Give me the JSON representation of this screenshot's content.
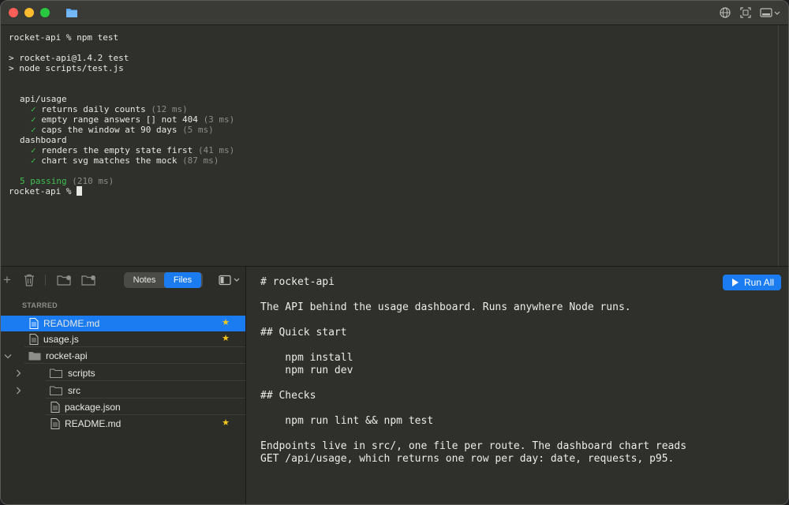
{
  "terminal": {
    "cmd_line": "rocket-api % npm test",
    "script_line1": "> rocket-api@1.4.2 test",
    "script_line2": "> node scripts/test.js",
    "suites": [
      {
        "name": "api/usage",
        "tests": [
          {
            "title": "returns daily counts",
            "time": "(12 ms)"
          },
          {
            "title": "empty range answers [] not 404",
            "time": "(3 ms)"
          },
          {
            "title": "caps the window at 90 days",
            "time": "(5 ms)"
          }
        ]
      },
      {
        "name": "dashboard",
        "tests": [
          {
            "title": "renders the empty state first",
            "time": "(41 ms)"
          },
          {
            "title": "chart svg matches the mock",
            "time": "(87 ms)"
          }
        ]
      }
    ],
    "check": "✓",
    "summary": "5 passing",
    "summary_time": "(210 ms)",
    "prompt": "rocket-api %"
  },
  "sidebar": {
    "tabs": {
      "notes": "Notes",
      "files": "Files"
    },
    "section_label": "STARRED",
    "starred": [
      {
        "name": "README.md",
        "starred": true,
        "selected": true
      },
      {
        "name": "usage.js",
        "starred": true,
        "selected": false
      }
    ],
    "tree": {
      "root": "rocket-api",
      "items": [
        {
          "name": "scripts",
          "type": "folder"
        },
        {
          "name": "src",
          "type": "folder"
        },
        {
          "name": "package.json",
          "type": "file",
          "starred": false
        },
        {
          "name": "README.md",
          "type": "file",
          "starred": true
        }
      ]
    },
    "star_glyph": "★"
  },
  "editor": {
    "run_label": "Run All",
    "lines": [
      "# rocket-api",
      "The API behind the usage dashboard. Runs anywhere Node runs.",
      "## Quick start",
      "    npm install",
      "    npm run dev",
      "## Checks",
      "    npm run lint && npm test",
      "Endpoints live in src/, one file per route. The dashboard chart reads",
      "GET /api/usage, which returns one row per day: date, requests, p95."
    ]
  },
  "colors": {
    "accent": "#1a7cf0",
    "pass": "#3fbf4f",
    "star": "#f7c81b"
  }
}
